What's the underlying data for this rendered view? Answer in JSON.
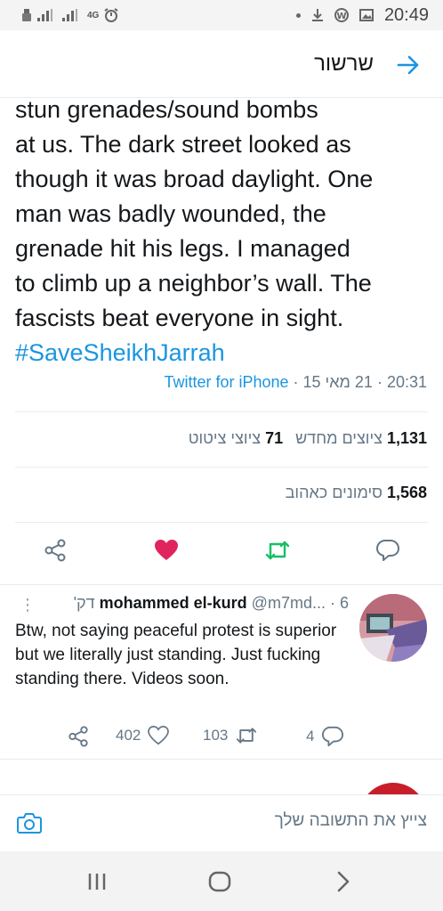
{
  "status_bar": {
    "network_label": "4G",
    "time": "20:49"
  },
  "header": {
    "title": "שרשור",
    "back_icon": "arrow-right-icon"
  },
  "tweet": {
    "text_lines": [
      "stun grenades/sound bombs",
      "at us. The dark street looked as",
      "though it was broad daylight. One",
      "man was badly wounded, the",
      "grenade hit his legs. I managed",
      "to climb up a neighbor’s wall. The",
      "fascists beat everyone in sight."
    ],
    "hashtag": "#SaveSheikhJarrah",
    "source": "Twitter for iPhone",
    "date": "21 מאי 15",
    "time": "20:31",
    "retweets_count": "1,131",
    "retweets_label": "ציוצים מחדש",
    "quotes_count": "71",
    "quotes_label": "ציוצי ציטוט",
    "likes_count": "1,568",
    "likes_label": "סימונים כאהוב",
    "colors": {
      "like": "#e0245e",
      "retweet": "#17bf63",
      "link": "#1b95e0"
    }
  },
  "reply": {
    "name": "mohammed el-kurd",
    "handle": "@m7md...",
    "age": "6 דק'",
    "text": "Btw, not saying peaceful protest is superior but we literally just standing. Just fucking standing there. Videos soon.",
    "likes": "402",
    "retweets": "103",
    "replies": "4"
  },
  "composer": {
    "placeholder": "צייץ את התשובה שלך"
  }
}
